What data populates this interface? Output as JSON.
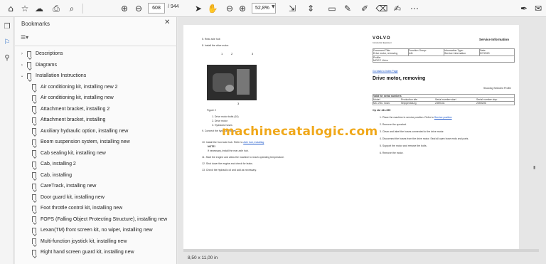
{
  "toolbar": {
    "page_number": "608",
    "page_total": "/ 944",
    "zoom": "52,8%",
    "icons": [
      "home-icon",
      "star-icon",
      "upload-icon",
      "print-icon",
      "find-icon",
      "prev-page-icon",
      "next-page-icon",
      "select-cursor-icon",
      "hand-tool-icon",
      "zoom-out-icon",
      "zoom-in-icon",
      "fit-page-icon",
      "scroll-mode-icon",
      "comment-icon",
      "highlight-icon",
      "draw-icon",
      "erase-icon",
      "fill-sign-icon",
      "more-tools-icon",
      "sign-icon",
      "mail-icon"
    ]
  },
  "rail": {
    "icons": [
      "pages-icon",
      "bookmark-icon",
      "attachments-icon"
    ]
  },
  "bookmarks": {
    "title": "Bookmarks",
    "items": [
      {
        "label": "Descriptions",
        "level": 0,
        "caret": "›"
      },
      {
        "label": "Diagrams",
        "level": 0,
        "caret": "›"
      },
      {
        "label": "Installation Instructions",
        "level": 0,
        "caret": "⌄"
      },
      {
        "label": "Air conditioning kit, installing new 2",
        "level": 1
      },
      {
        "label": "Air conditioning kit, installing new",
        "level": 1
      },
      {
        "label": "Attachment bracket, installing 2",
        "level": 1
      },
      {
        "label": "Attachment bracket, installing",
        "level": 1
      },
      {
        "label": "Auxiliary hydraulic option, installing new",
        "level": 1
      },
      {
        "label": "Boom suspension system, installing new",
        "level": 1
      },
      {
        "label": "Cab sealing kit, installing new",
        "level": 1
      },
      {
        "label": "Cab, installing 2",
        "level": 1
      },
      {
        "label": "Cab, installing",
        "level": 1
      },
      {
        "label": "CareTrack, installing new",
        "level": 1
      },
      {
        "label": "Door guard kit, installing new",
        "level": 1
      },
      {
        "label": "Foot throttle control kit, installing new",
        "level": 1
      },
      {
        "label": "FOPS (Falling Object Protecting Structure), installing new",
        "level": 1
      },
      {
        "label": "Lexan(TM) front screen kit, no wiper, installing new",
        "level": 1
      },
      {
        "label": "Multi-function joystick kit, installing new",
        "level": 1
      },
      {
        "label": "Right hand screen guard kit, installing new",
        "level": 1
      }
    ]
  },
  "left_page": {
    "step5": "5.    Rear axle hub",
    "step8": "8.    Install the drive motor.",
    "callouts": [
      "1",
      "2",
      "3",
      "3"
    ],
    "figure": "Figure 2",
    "legend": [
      "1.    Drive motor bolts (10)",
      "2.    Drive motor",
      "3.    Hydraulic hoses"
    ],
    "step9": "9.    Connect the hydraulic hoses.",
    "step10a": "10.  Install the front axle hub. Refer to",
    "step10_link": "Axle hub, installing",
    "note_label": "NOTE!",
    "note": "If necessary, install the rear axle hub.",
    "step11": "11.  Start the engine and allow the machine to reach operating temperature.",
    "step12": "12.  Shut down the engine and check for leaks.",
    "step13": "13.  Check the hydraulic oil and add as necessary."
  },
  "right_page": {
    "brand": "VOLVO",
    "brand_sub": "Construction Equipment",
    "service_info": "Service Information",
    "table_headers": [
      "Document Title:",
      "Function Group:",
      "Information Type:",
      "Date:"
    ],
    "table_values": [
      "Drive motor, removing",
      "441",
      "Service Information",
      "5/7/2020"
    ],
    "profile_label": "Profile:",
    "profile_value": "MC/EC Volvo",
    "back_link": "Go back to Index Page",
    "heading": "Drive motor, removing",
    "showing_profile": "Showing Selected Profile",
    "serial_header": "Valid for serial numbers",
    "serial_cols": [
      "Model",
      "Production site",
      "Serial number start",
      "Serial number stop"
    ],
    "serial_vals": [
      "MC-VSC Volvo",
      "Shippensburg",
      "2359131",
      "2359206"
    ],
    "op_nbr": "Op nbr 441-055",
    "steps": [
      "1.   Place the machine in service position. Refer to",
      "2.   Remove the sprocket.",
      "3.   Clean and label the hoses connected to the drive motor.",
      "4.   Disconnect the hoses from the drive motor. Seal all open hose ends and ports.",
      "5.   Support the motor and remove the bolts.",
      "6.   Remove the motor."
    ],
    "step1_link": "Service position"
  },
  "watermark": "machinecatalogic.com",
  "status": {
    "page_size": "8,50 x 11,00 in"
  },
  "colors": {
    "watermark": "#f0a81a",
    "link": "#1a55c9",
    "accent": "#2c6ec8"
  }
}
